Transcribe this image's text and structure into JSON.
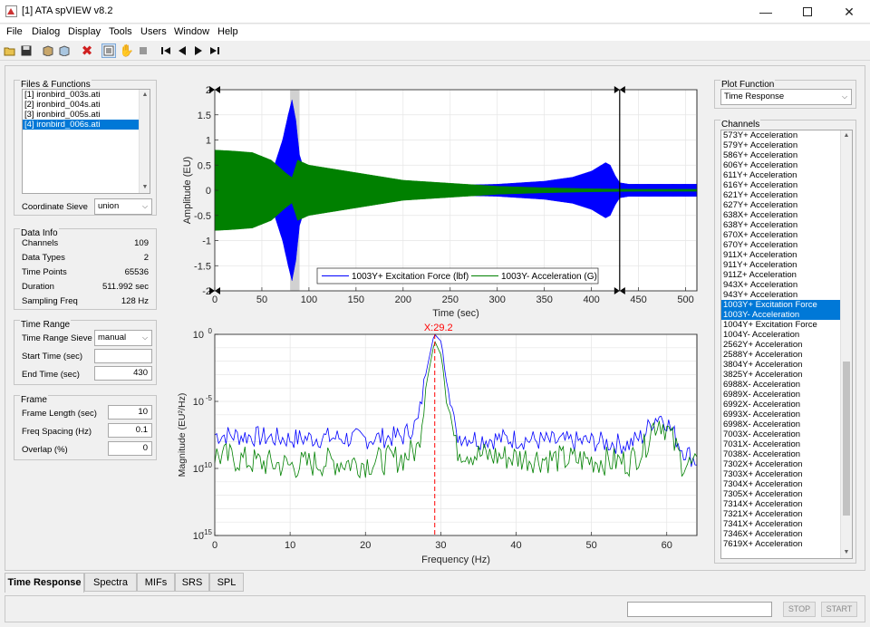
{
  "window": {
    "title": "[1] ATA spVIEW v8.2"
  },
  "menu": [
    "File",
    "Dialog",
    "Display",
    "Tools",
    "Users",
    "Window",
    "Help"
  ],
  "toolbar_icons": [
    "open-folder-icon",
    "save-icon",
    "box-icon",
    "box-alt-icon",
    "delete-icon",
    "list-icon",
    "pan-hand-icon",
    "cursor-icon",
    "first-icon",
    "prev-icon",
    "next-icon",
    "last-icon"
  ],
  "files_functions": {
    "title": "Files & Functions",
    "files": [
      "[1] ironbird_003s.ati",
      "[2] ironbird_004s.ati",
      "[3] ironbird_005s.ati",
      "[4] ironbird_006s.ati"
    ],
    "selected_index": 3,
    "coordinate_sieve_label": "Coordinate Sieve",
    "coordinate_sieve_value": "union"
  },
  "data_info": {
    "title": "Data Info",
    "rows": [
      {
        "label": "Channels",
        "value": "109"
      },
      {
        "label": "Data Types",
        "value": "2"
      },
      {
        "label": "Time Points",
        "value": "65536"
      },
      {
        "label": "Duration",
        "value": "511.992 sec"
      },
      {
        "label": "Sampling Freq",
        "value": "128 Hz"
      }
    ]
  },
  "time_range": {
    "title": "Time Range",
    "sieve_label": "Time Range Sieve",
    "sieve_value": "manual",
    "start_label": "Start Time (sec)",
    "start_value": "",
    "end_label": "End Time (sec)",
    "end_value": "430"
  },
  "frame": {
    "title": "Frame",
    "rows": [
      {
        "label": "Frame Length (sec)",
        "value": "10"
      },
      {
        "label": "Freq Spacing (Hz)",
        "value": "0.1"
      },
      {
        "label": "Overlap (%)",
        "value": "0"
      }
    ]
  },
  "plot_function": {
    "title": "Plot Function",
    "value": "Time Response"
  },
  "channels": {
    "title": "Channels",
    "items": [
      "573Y+ Acceleration",
      "579Y+ Acceleration",
      "586Y+ Acceleration",
      "606Y+ Acceleration",
      "611Y+ Acceleration",
      "616Y+ Acceleration",
      "621Y+ Acceleration",
      "627Y+ Acceleration",
      "638X+ Acceleration",
      "638Y+ Acceleration",
      "670X+ Acceleration",
      "670Y+ Acceleration",
      "911X+ Acceleration",
      "911Y+ Acceleration",
      "911Z+ Acceleration",
      "943X+ Acceleration",
      "943Y+ Acceleration",
      "1003Y+ Excitation Force",
      "1003Y- Acceleration",
      "1004Y+ Excitation Force",
      "1004Y- Acceleration",
      "2562Y+ Acceleration",
      "2588Y+ Acceleration",
      "3804Y+ Acceleration",
      "3825Y+ Acceleration",
      "6988X- Acceleration",
      "6989X- Acceleration",
      "6992X- Acceleration",
      "6993X- Acceleration",
      "6998X- Acceleration",
      "7003X- Acceleration",
      "7031X- Acceleration",
      "7038X- Acceleration",
      "7302X+ Acceleration",
      "7303X+ Acceleration",
      "7304X+ Acceleration",
      "7305X+ Acceleration",
      "7314X+ Acceleration",
      "7321X+ Acceleration",
      "7341X+ Acceleration",
      "7346X+ Acceleration",
      "7619X+ Acceleration"
    ],
    "selected": [
      17,
      18
    ]
  },
  "tabs": [
    "Time Response",
    "Spectra",
    "MIFs",
    "SRS",
    "SPL"
  ],
  "active_tab": 0,
  "status": {
    "stop_label": "STOP",
    "start_label": "START"
  },
  "colors": {
    "series1": "#0000ff",
    "series2": "#008000",
    "cursor": "#ff0000",
    "selection": "#0078d7"
  },
  "chart_data": [
    {
      "type": "line",
      "title": "",
      "xlabel": "Time (sec)",
      "ylabel": "Amplitude (EU)",
      "xlim": [
        0,
        512
      ],
      "ylim": [
        -2,
        2
      ],
      "xticks": [
        0,
        50,
        100,
        150,
        200,
        250,
        300,
        350,
        400,
        450,
        500
      ],
      "yticks": [
        -2,
        -1.5,
        -1,
        -0.5,
        0,
        0.5,
        1,
        1.5,
        2
      ],
      "grid": true,
      "legend": "bottom-center",
      "series": [
        {
          "name": "1003Y+ Excitation Force (lbf)",
          "envelope_x": [
            0,
            40,
            60,
            72,
            78,
            82,
            86,
            90,
            95,
            110,
            150,
            200,
            250,
            300,
            350,
            380,
            400,
            415,
            420,
            425,
            430,
            440,
            470,
            512
          ],
          "envelope_amp": [
            0.02,
            0.05,
            0.3,
            1.0,
            1.5,
            1.8,
            1.4,
            0.7,
            0.4,
            0.3,
            0.2,
            0.12,
            0.1,
            0.12,
            0.18,
            0.26,
            0.38,
            0.55,
            0.5,
            0.3,
            0.15,
            0.12,
            0.12,
            0.12
          ]
        },
        {
          "name": "1003Y- Acceleration (G)",
          "envelope_x": [
            0,
            20,
            40,
            60,
            75,
            82,
            88,
            100,
            150,
            200,
            250,
            300,
            350,
            400,
            450,
            512
          ],
          "envelope_amp": [
            0.8,
            0.78,
            0.75,
            0.6,
            0.35,
            0.25,
            0.6,
            0.5,
            0.35,
            0.2,
            0.14,
            0.08,
            0.05,
            0.03,
            0.02,
            0.02
          ]
        }
      ],
      "highlight_band": [
        80,
        90
      ],
      "cursor_x": 430
    },
    {
      "type": "line",
      "title": "",
      "xlabel": "Frequency (Hz)",
      "ylabel": "Magnitude (EU²/Hz)",
      "xlim": [
        0,
        64
      ],
      "ylim_log10": [
        -15,
        0
      ],
      "xticks": [
        0,
        10,
        20,
        30,
        40,
        50,
        60
      ],
      "yticks_log10": [
        -15,
        -10,
        -5,
        0
      ],
      "yscale": "log",
      "grid": true,
      "cursor_x": 29.2,
      "cursor_label": "X:29.2",
      "series": [
        {
          "name": "blue",
          "x": [
            0,
            5,
            10,
            15,
            20,
            25,
            27,
            28,
            29,
            29.2,
            30,
            31,
            32,
            35,
            40,
            45,
            50,
            55,
            57,
            58,
            59,
            60,
            62,
            64
          ],
          "log10_y": [
            -7.5,
            -7.6,
            -7.8,
            -7.7,
            -7.8,
            -7.6,
            -6.5,
            -3,
            -0.3,
            0,
            -0.5,
            -3.5,
            -7.5,
            -7.8,
            -7.8,
            -8.0,
            -8.0,
            -8.2,
            -7.5,
            -6.5,
            -6.0,
            -6.5,
            -8.5,
            -9.5
          ]
        },
        {
          "name": "green",
          "x": [
            0,
            5,
            10,
            15,
            20,
            25,
            27,
            28,
            29,
            29.2,
            30,
            31,
            32,
            35,
            40,
            45,
            50,
            55,
            57,
            58,
            59,
            60,
            62,
            64
          ],
          "log10_y": [
            -9.0,
            -9.5,
            -9.8,
            -9.5,
            -9.6,
            -9.2,
            -8.5,
            -4,
            -1,
            -0.5,
            -1.5,
            -5,
            -8.5,
            -9.0,
            -9.2,
            -9.3,
            -9.4,
            -9.5,
            -8.5,
            -7.0,
            -6.4,
            -7.0,
            -9.5,
            -10.0
          ]
        }
      ]
    }
  ]
}
